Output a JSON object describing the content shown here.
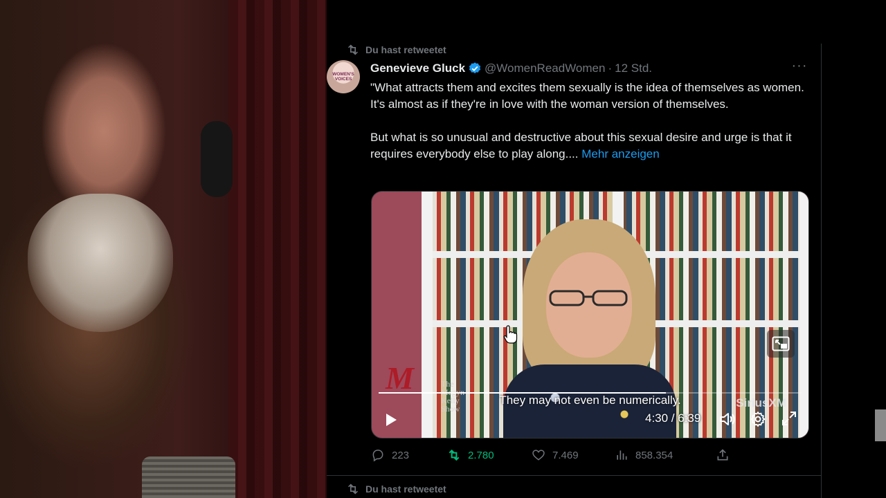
{
  "retweet_banner": {
    "label": "Du hast retweetet"
  },
  "tweet": {
    "avatar_text": "WOMEN'S VOICES",
    "author_name": "Genevieve Gluck",
    "author_handle": "@WomenReadWomen",
    "separator": "·",
    "time": "12 Std.",
    "more_icon": "more-dots-icon",
    "paragraph1": "\"What attracts them and excites them sexually is the idea of themselves as women. It's almost as if they're in love with the woman version of themselves.",
    "paragraph2": "But what is so unusual and destructive about this sexual desire and urge is that it requires everybody else to play along....",
    "show_more": "Mehr anzeigen",
    "video": {
      "caption": "They may not even be numerically.",
      "watermark_line1": "The",
      "watermark_line2": "Megyn",
      "watermark_line3": "Kelly",
      "watermark_line4": "Show",
      "brand": "SiriusXM",
      "time_display": "4:30 / 6:39",
      "progress": 0.68
    },
    "stats": {
      "replies": "223",
      "retweets": "2.780",
      "likes": "7.469",
      "views": "858.354"
    }
  },
  "next_retweet_banner": {
    "label": "Du hast retweetet"
  },
  "colors": {
    "accent": "#1d9bf0",
    "retweet_green": "#00ba7c",
    "muted": "#71767b",
    "text": "#e7e9ea",
    "border": "#2f3336"
  }
}
